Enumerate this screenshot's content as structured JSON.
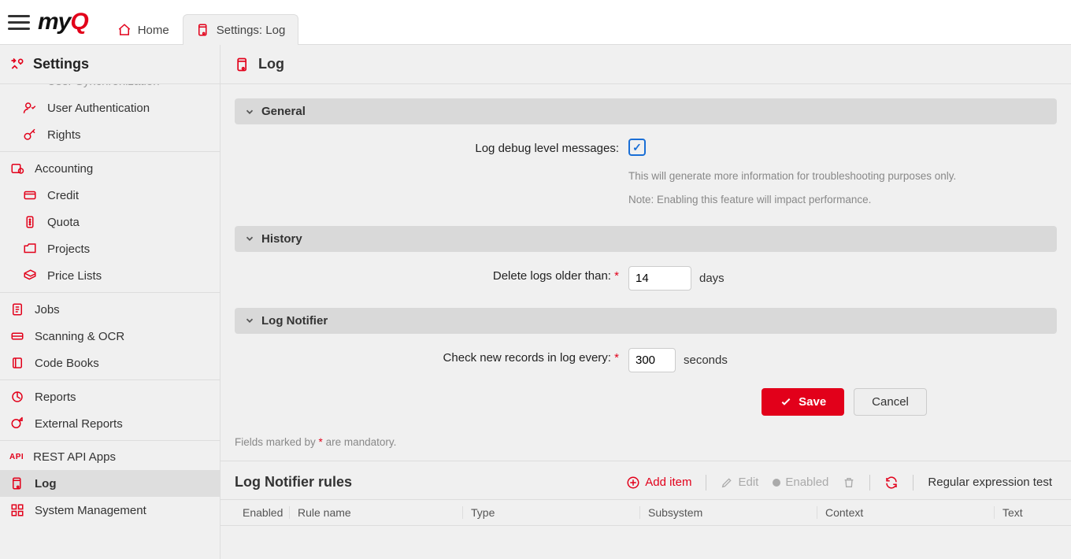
{
  "header": {
    "home_label": "Home",
    "settings_tab_label": "Settings: Log"
  },
  "sidebar": {
    "title": "Settings",
    "items": {
      "user_sync": "User Synchronization",
      "user_auth": "User Authentication",
      "rights": "Rights",
      "accounting": "Accounting",
      "credit": "Credit",
      "quota": "Quota",
      "projects": "Projects",
      "price_lists": "Price Lists",
      "jobs": "Jobs",
      "scanning": "Scanning & OCR",
      "code_books": "Code Books",
      "reports": "Reports",
      "external_reports": "External Reports",
      "rest_api": "REST API Apps",
      "log": "Log",
      "sys_mgmt": "System Management"
    }
  },
  "page": {
    "title": "Log",
    "sections": {
      "general": {
        "title": "General",
        "debug_label": "Log debug level messages:",
        "debug_checked": true,
        "debug_hint1": "This will generate more information for troubleshooting purposes only.",
        "debug_hint2": "Note: Enabling this feature will impact performance."
      },
      "history": {
        "title": "History",
        "delete_label": "Delete logs older than:",
        "delete_value": "14",
        "delete_unit": "days"
      },
      "notifier": {
        "title": "Log Notifier",
        "check_label": "Check new records in log every:",
        "check_value": "300",
        "check_unit": "seconds"
      }
    },
    "buttons": {
      "save": "Save",
      "cancel": "Cancel"
    },
    "mandatory_note_pre": "Fields marked by ",
    "mandatory_note_post": " are mandatory."
  },
  "rules": {
    "title": "Log Notifier rules",
    "toolbar": {
      "add": "Add item",
      "edit": "Edit",
      "enabled": "Enabled",
      "regex": "Regular expression test"
    },
    "columns": {
      "enabled": "Enabled",
      "name": "Rule name",
      "type": "Type",
      "subsystem": "Subsystem",
      "context": "Context",
      "text": "Text"
    }
  }
}
